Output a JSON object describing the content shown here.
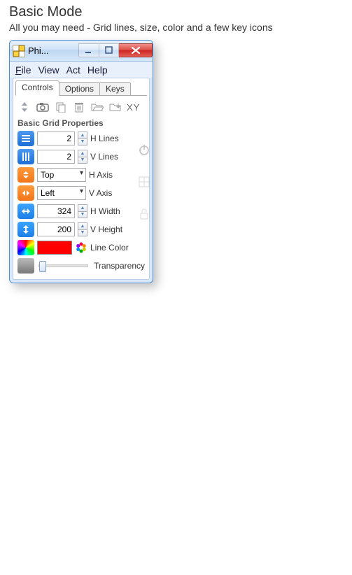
{
  "page": {
    "title": "Basic Mode",
    "subtitle": "All you may need - Grid lines, size, color and a few key icons"
  },
  "window": {
    "app_title": "Phi..."
  },
  "menu": {
    "file": "File",
    "view": "View",
    "act": "Act",
    "help": "Help"
  },
  "tabs": {
    "controls": "Controls",
    "options": "Options",
    "keys": "Keys"
  },
  "toolbar": {
    "xy": "XY"
  },
  "section": {
    "title": "Basic Grid Properties"
  },
  "props": {
    "hlines": {
      "value": "2",
      "label": "H Lines"
    },
    "vlines": {
      "value": "2",
      "label": "V Lines"
    },
    "haxis": {
      "value": "Top",
      "label": "H Axis"
    },
    "vaxis": {
      "value": "Left",
      "label": "V Axis"
    },
    "hwidth": {
      "value": "324",
      "label": "H Width"
    },
    "vheight": {
      "value": "200",
      "label": "V Height"
    },
    "linecolor": {
      "value": "#ff0000",
      "label": "Line Color"
    },
    "transparency": {
      "value": 0,
      "label": "Transparency"
    }
  }
}
